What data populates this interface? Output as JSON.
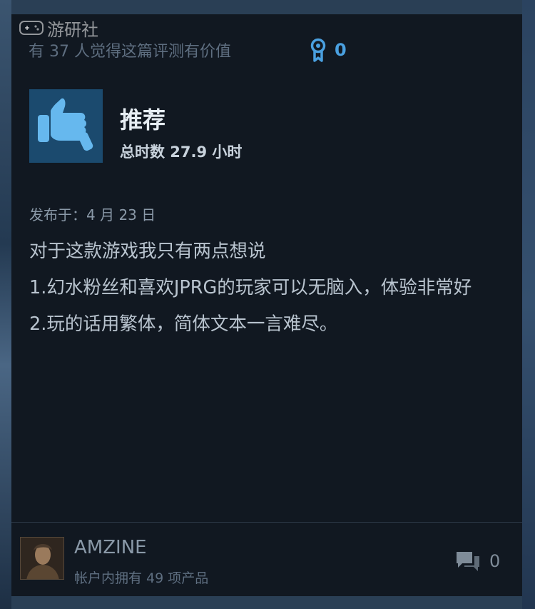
{
  "watermark": {
    "text": "游研社"
  },
  "review": {
    "helpful_text": "有 37 人觉得这篇评测有价值",
    "award_count": "0",
    "recommendation": "推荐",
    "hours": "总时数 27.9 小时",
    "posted": "发布于：4 月 23 日",
    "lines": [
      "对于这款游戏我只有两点想说",
      "1.幻水粉丝和喜欢JPRG的玩家可以无脑入，体验非常好",
      "2.玩的话用繁体，简体文本一言难尽。"
    ]
  },
  "author": {
    "name": "AMZINE",
    "products": "帐户内拥有 49 项产品",
    "comment_count": "0"
  },
  "icons": {
    "award": "award-ribbon-icon",
    "thumb": "thumbs-up-icon",
    "comments": "comments-icon"
  },
  "colors": {
    "card_bg": "#111821",
    "accent": "#4aa0e0",
    "thumb_bg": "#1b4a6e",
    "thumb_fg": "#66b8ee"
  }
}
